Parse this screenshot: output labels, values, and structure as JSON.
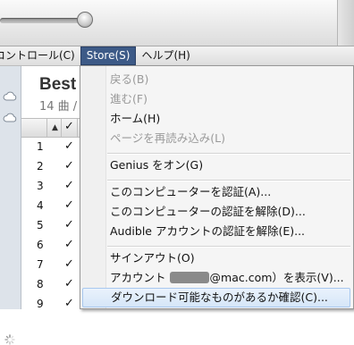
{
  "menubar": {
    "items": [
      {
        "label": "コントロール(C)"
      },
      {
        "label": "Store(S)"
      },
      {
        "label": "ヘルプ(H)"
      }
    ]
  },
  "playlist": {
    "title": "Best H",
    "subtitle": "14 曲 /"
  },
  "table": {
    "rows": [
      "1",
      "2",
      "3",
      "4",
      "5",
      "6",
      "7",
      "8",
      "9"
    ],
    "check": "✓"
  },
  "store_menu": {
    "back": "戻る(B)",
    "forward": "進む(F)",
    "home": "ホーム(H)",
    "reload": "ページを再読み込み(L)",
    "genius": "Genius をオン(G)",
    "authorize": "このコンピューターを認証(A)...",
    "deauthorize": "このコンピューターの認証を解除(D)...",
    "audible_deauth": "Audible アカウントの認証を解除(E)...",
    "sign_out": "サインアウト(O)",
    "account_prefix": "アカウント",
    "account_suffix": "@mac.com）を表示(V)...",
    "check_downloads": "ダウンロード可能なものがあるか確認(C)..."
  },
  "colors": {
    "menu_active": "#3d5a87",
    "hover_bg": "#d6e6f8"
  }
}
